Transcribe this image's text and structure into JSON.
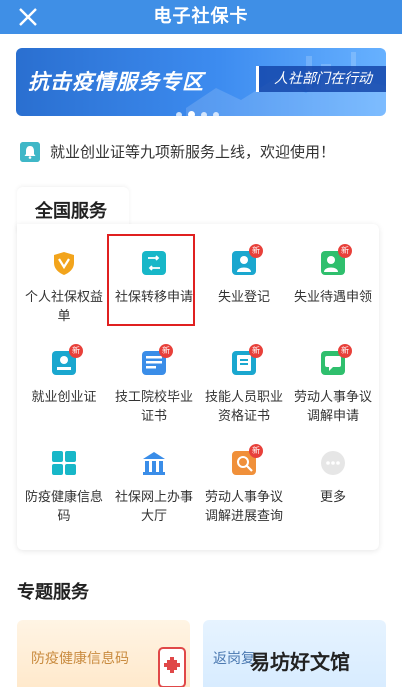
{
  "header": {
    "title": "电子社保卡"
  },
  "banner": {
    "main": "抗击疫情服务专区",
    "sub": "人社部门在行动"
  },
  "notice": {
    "text": "就业创业证等九项新服务上线，欢迎使用！"
  },
  "national": {
    "title": "全国服务",
    "new_badge": "新",
    "items": [
      {
        "label": "个人社保权益单",
        "icon": "shield-v-icon",
        "color": "#f2a41c",
        "new": false
      },
      {
        "label": "社保转移申请",
        "icon": "transfer-icon",
        "color": "#17b7c8",
        "new": false
      },
      {
        "label": "失业登记",
        "icon": "person-register-icon",
        "color": "#1aa7cf",
        "new": true
      },
      {
        "label": "失业待遇申领",
        "icon": "benefit-claim-icon",
        "color": "#2fbf6d",
        "new": true
      },
      {
        "label": "就业创业证",
        "icon": "id-card-icon",
        "color": "#1aa7cf",
        "new": true
      },
      {
        "label": "技工院校毕业证书",
        "icon": "certificate-icon",
        "color": "#3a8de8",
        "new": true
      },
      {
        "label": "技能人员职业资格证书",
        "icon": "qualification-icon",
        "color": "#1aa7cf",
        "new": true
      },
      {
        "label": "劳动人事争议调解申请",
        "icon": "dispute-apply-icon",
        "color": "#2fbf6d",
        "new": true
      },
      {
        "label": "防疫健康信息码",
        "icon": "qr-grid-icon",
        "color": "#17b7c8",
        "new": false
      },
      {
        "label": "社保网上办事大厅",
        "icon": "service-hall-icon",
        "color": "#3a8de8",
        "new": false
      },
      {
        "label": "劳动人事争议调解进展查询",
        "icon": "progress-query-icon",
        "color": "#f0903a",
        "new": true
      },
      {
        "label": "更多",
        "icon": "more-icon",
        "color": "#cccccc",
        "new": false
      }
    ]
  },
  "topics": {
    "title": "专题服务",
    "cards": [
      {
        "label": "防疫健康信息码"
      },
      {
        "label": "返岗复"
      }
    ]
  },
  "watermark": "易坊好文馆"
}
